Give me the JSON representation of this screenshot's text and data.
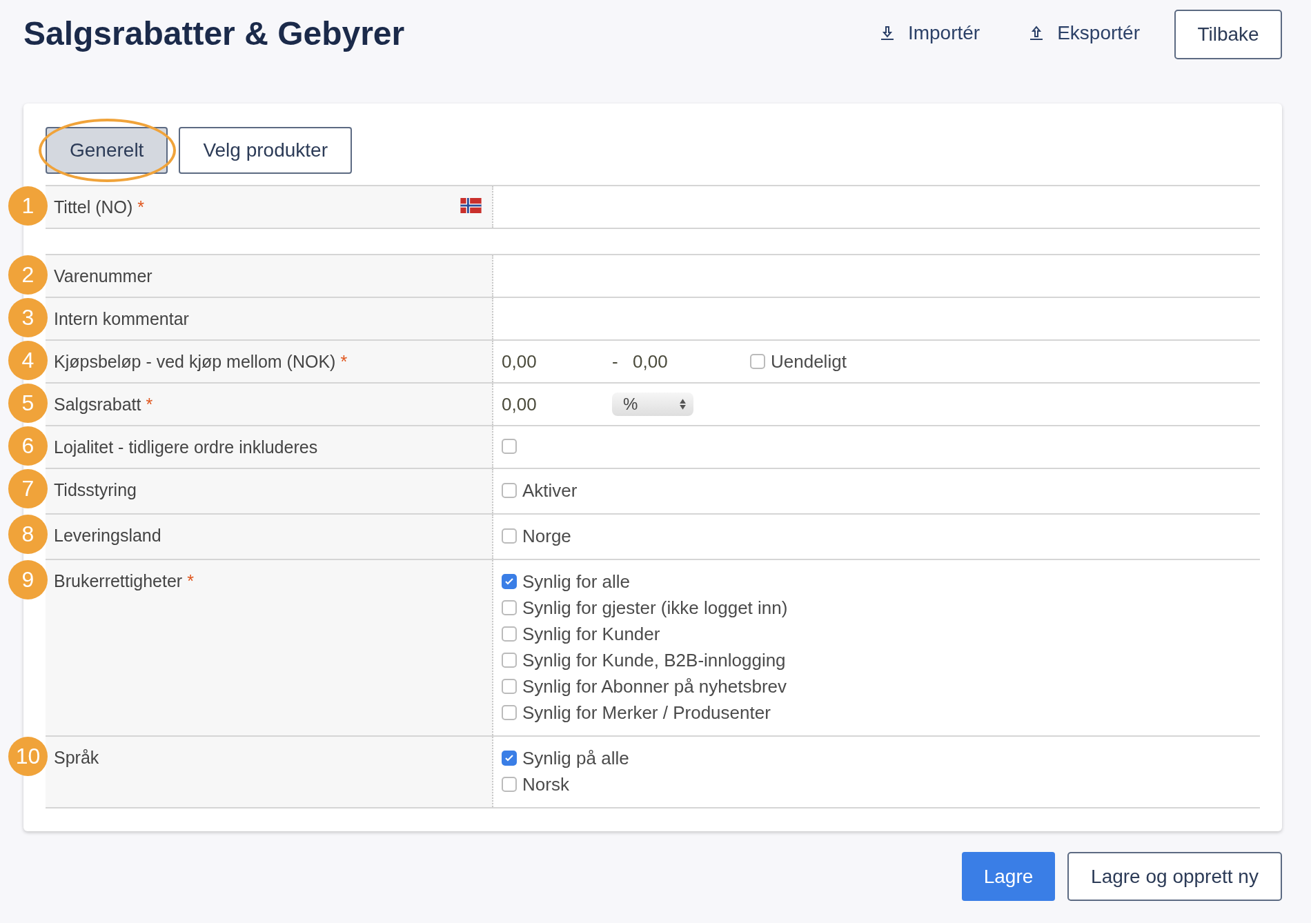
{
  "page": {
    "title": "Salgsrabatter & Gebyrer"
  },
  "header_actions": [
    {
      "kind": "import",
      "label": "Importér"
    },
    {
      "kind": "export",
      "label": "Eksportér"
    },
    {
      "kind": "button",
      "label": "Tilbake"
    }
  ],
  "tabs": [
    {
      "label": "Generelt",
      "selected": true,
      "circled": true
    },
    {
      "label": "Velg produkter",
      "selected": false,
      "circled": false
    }
  ],
  "rows": [
    {
      "kind": "text",
      "badge": "1",
      "label": "Tittel (NO)",
      "required_mark": "*",
      "flag": true
    },
    {
      "kind": "spacer"
    },
    {
      "kind": "text",
      "badge": "2",
      "label": "Varenummer",
      "flag": false
    },
    {
      "kind": "text",
      "badge": "3",
      "label": "Intern kommentar",
      "flag": false
    },
    {
      "kind": "range",
      "badge": "4",
      "label": "Kjøpsbeløp - ved kjøp mellom (NOK)",
      "required_mark": "*",
      "from": "0,00",
      "separator": "-",
      "to": "0,00",
      "option": {
        "label": "Uendeligt",
        "checked": false
      }
    },
    {
      "kind": "discount",
      "badge": "5",
      "label": "Salgsrabatt",
      "required_mark": "*",
      "value": "0,00",
      "unit": "%"
    },
    {
      "kind": "checks",
      "badge": "6",
      "label": "Lojalitet - tidligere ordre inkluderes",
      "options": [
        {
          "checked": false
        }
      ]
    },
    {
      "kind": "checks",
      "badge": "7",
      "label": "Tidsstyring",
      "options": [
        {
          "label": "Aktiver",
          "checked": false
        }
      ]
    },
    {
      "kind": "checks",
      "badge": "8",
      "label": "Leveringsland",
      "options": [
        {
          "label": "Norge",
          "checked": false
        }
      ]
    },
    {
      "kind": "checks",
      "badge": "9",
      "label": "Brukerrettigheter",
      "required_mark": "*",
      "options": [
        {
          "label": "Synlig for alle",
          "checked": true
        },
        {
          "label": "Synlig for gjester (ikke logget inn)",
          "checked": false
        },
        {
          "label": "Synlig for Kunder",
          "checked": false
        },
        {
          "label": "Synlig for Kunde, B2B-innlogging",
          "checked": false
        },
        {
          "label": "Synlig for Abonner på nyhetsbrev",
          "checked": false
        },
        {
          "label": "Synlig for Merker / Produsenter",
          "checked": false
        }
      ]
    },
    {
      "kind": "checks",
      "badge": "10",
      "label": "Språk",
      "options": [
        {
          "label": "Synlig på alle",
          "checked": true
        },
        {
          "label": "Norsk",
          "checked": false
        }
      ]
    }
  ],
  "footer_buttons": [
    {
      "label": "Lagre",
      "primary": true
    },
    {
      "label": "Lagre og opprett ny",
      "primary": false
    }
  ]
}
